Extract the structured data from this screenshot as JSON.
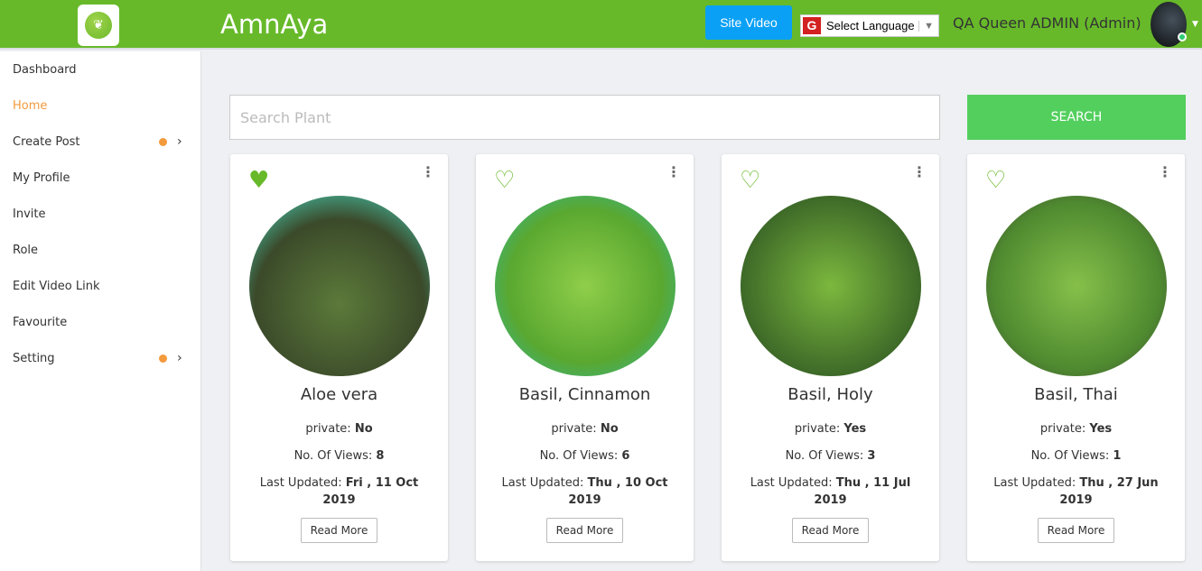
{
  "header": {
    "title": "AmnAya",
    "site_video": "Site Video",
    "language": "Select Language",
    "user": "QA Queen ADMIN (Admin)"
  },
  "sidebar": {
    "items": [
      {
        "label": "Dashboard"
      },
      {
        "label": "Home"
      },
      {
        "label": "Create Post"
      },
      {
        "label": "My Profile"
      },
      {
        "label": "Invite"
      },
      {
        "label": "Role"
      },
      {
        "label": "Edit Video Link"
      },
      {
        "label": "Favourite"
      },
      {
        "label": "Setting"
      }
    ]
  },
  "search": {
    "placeholder": "Search Plant",
    "button": "SEARCH"
  },
  "labels": {
    "private": "private: ",
    "views": "No. Of Views: ",
    "updated": "Last Updated: ",
    "read_more": "Read More"
  },
  "plants": [
    {
      "name": "Aloe vera",
      "private": "No",
      "views": "8",
      "updated": "Fri , 11 Oct 2019",
      "favourite": true
    },
    {
      "name": "Basil, Cinnamon",
      "private": "No",
      "views": "6",
      "updated": "Thu , 10 Oct 2019",
      "favourite": false
    },
    {
      "name": "Basil, Holy",
      "private": "Yes",
      "views": "3",
      "updated": "Thu , 11 Jul 2019",
      "favourite": false
    },
    {
      "name": "Basil, Thai",
      "private": "Yes",
      "views": "1",
      "updated": "Thu , 27 Jun 2019",
      "favourite": false
    }
  ],
  "colors": {
    "brand": "#67b92a",
    "accent": "#f39a3c",
    "search": "#53cf5e",
    "video": "#0aa0f5"
  }
}
